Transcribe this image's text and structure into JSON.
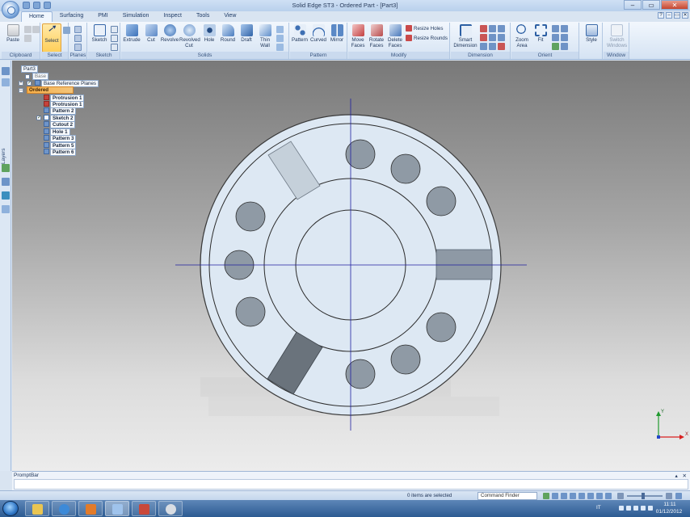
{
  "window": {
    "title": "Solid Edge ST3 - Ordered Part - [Part3]",
    "minimize_glyph": "–",
    "maximize_glyph": "▭",
    "close_glyph": "✕"
  },
  "help_buttons": [
    "?",
    "–",
    "▭",
    "✕"
  ],
  "tabs": [
    {
      "label": "Home",
      "active": true
    },
    {
      "label": "Surfacing"
    },
    {
      "label": "PMI"
    },
    {
      "label": "Simulation"
    },
    {
      "label": "Inspect"
    },
    {
      "label": "Tools"
    },
    {
      "label": "View"
    }
  ],
  "ribbon": {
    "groups": {
      "clipboard": "Clipboard",
      "select": "Select",
      "planes": "Planes",
      "sketch": "Sketch",
      "solids": "Solids",
      "pattern": "Pattern",
      "modify": "Modify",
      "dimension": "Dimension",
      "orient": "Orient",
      "window": "Window"
    },
    "buttons": {
      "paste": "Paste",
      "select": "Select",
      "sketch": "Sketch",
      "extrude": "Extrude",
      "cut": "Cut",
      "revolve": "Revolve",
      "revolved_cut_1": "Revolved",
      "revolved_cut_2": "Cut",
      "hole": "Hole",
      "round": "Round",
      "draft": "Draft",
      "thin_wall_1": "Thin",
      "thin_wall_2": "Wall",
      "pattern": "Pattern",
      "curved": "Curved",
      "mirror": "Mirror",
      "move_faces_1": "Move",
      "move_faces_2": "Faces",
      "rotate_faces_1": "Rotate",
      "rotate_faces_2": "Faces",
      "delete_faces_1": "Delete",
      "delete_faces_2": "Faces",
      "resize_holes": "Resize Holes",
      "resize_rounds": "Resize Rounds",
      "smart_dimension_1": "Smart",
      "smart_dimension_2": "Dimension",
      "zoom_area_1": "Zoom",
      "zoom_area_2": "Area",
      "fit": "Fit",
      "style": "Style",
      "switch_windows_1": "Switch",
      "switch_windows_2": "Windows"
    }
  },
  "left_bar": {
    "layers": "Layers"
  },
  "pathfinder": {
    "root": "Part3",
    "base": "Base",
    "base_reference_planes": "Base Reference Planes",
    "ordered": "Ordered",
    "features": [
      "Protrusion 1",
      "Protrusion 1",
      "Pattern 2",
      "Sketch 2",
      "Cutout 2",
      "Hole 1",
      "Pattern 3",
      "Pattern 5",
      "Pattern 6"
    ]
  },
  "triad": {
    "x_label": "X",
    "y_label": "Y",
    "x_color": "#d92020",
    "y_color": "#1f9a2e",
    "z_color": "#2446c9"
  },
  "promptbar": {
    "title": "PromptBar",
    "controls": "▴ ✕"
  },
  "statusbar": {
    "selection": "0 items are selected",
    "command_finder": "Command Finder"
  },
  "taskbar": {
    "language": "IT",
    "time": "11:11",
    "date": "01/12/2012"
  },
  "colors": {
    "accent": "#f7b04a",
    "part_face": "#dde8f3",
    "part_edge": "#2b2b2b",
    "axis": "#1f1fa0"
  }
}
